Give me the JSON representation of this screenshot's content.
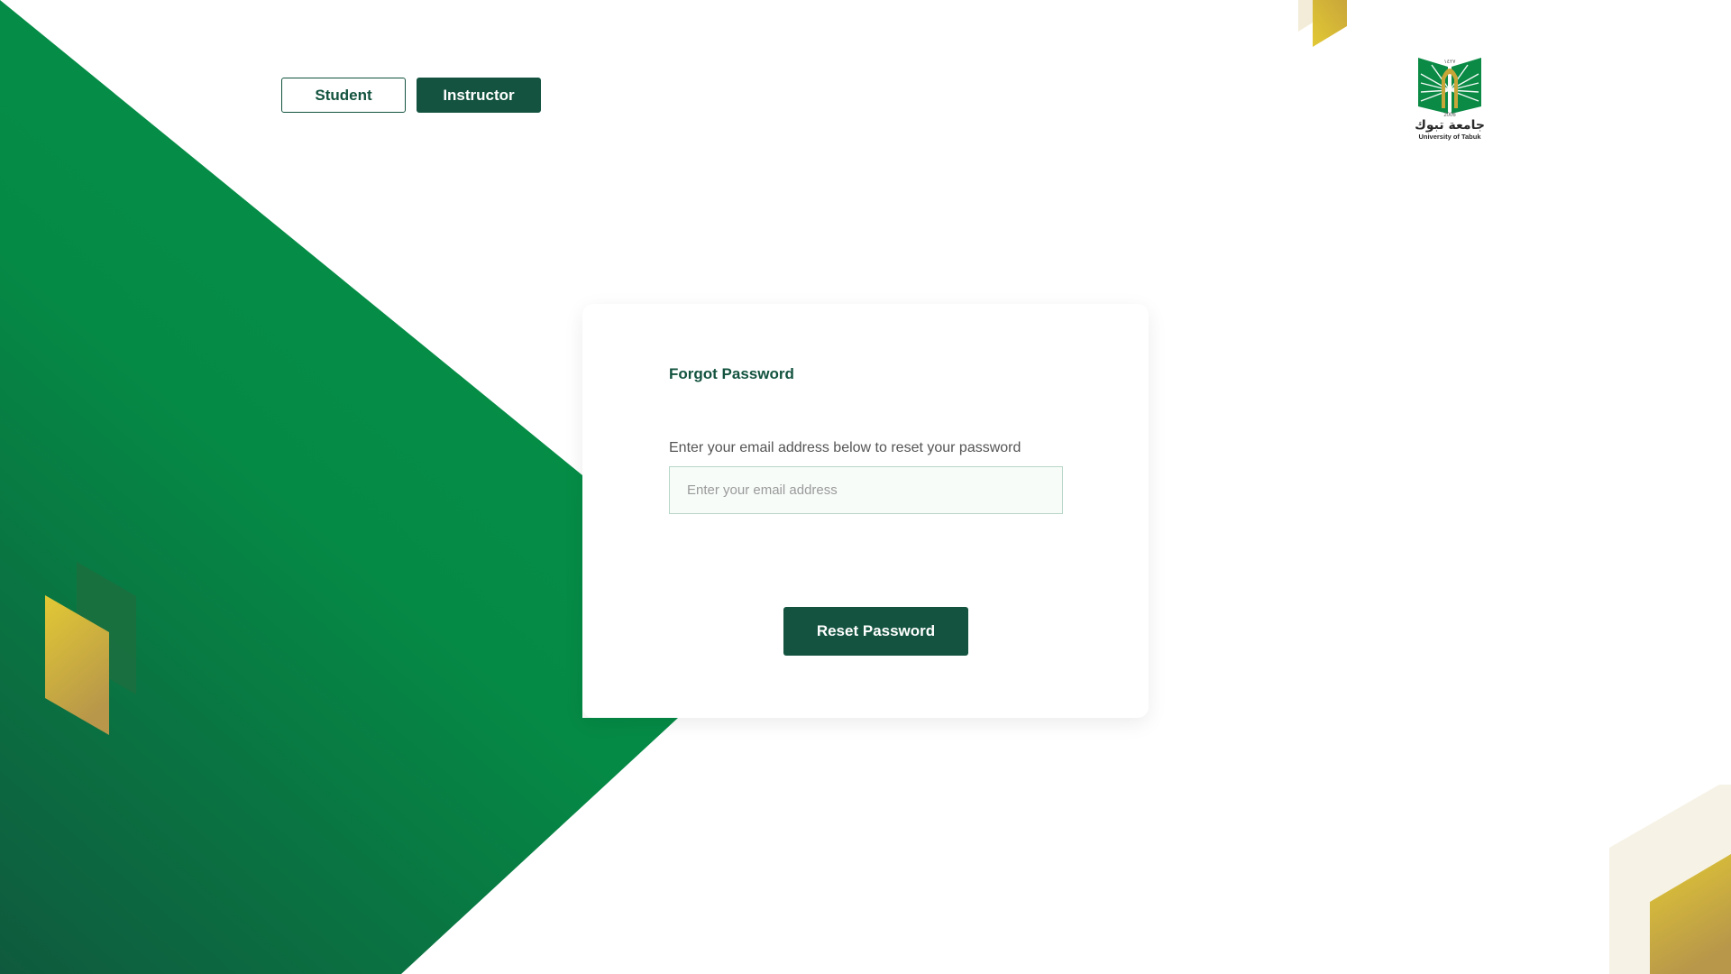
{
  "role_tabs": {
    "student_label": "Student",
    "instructor_label": "Instructor",
    "selected": "Instructor"
  },
  "logo": {
    "arabic_name": "جامعة تبوك",
    "english_name": "University of Tabuk",
    "year_hijri": "١٤٢٧",
    "year": "2006"
  },
  "card": {
    "title": "Forgot Password",
    "description": "Enter your email address below to reset your password",
    "email_placeholder": "Enter your email address",
    "email_value": "",
    "submit_label": "Reset Password"
  },
  "colors": {
    "primary": "#13533f",
    "green_bright": "#068a47",
    "gold": "#c9a63a",
    "input_border": "#b9d7c8"
  }
}
